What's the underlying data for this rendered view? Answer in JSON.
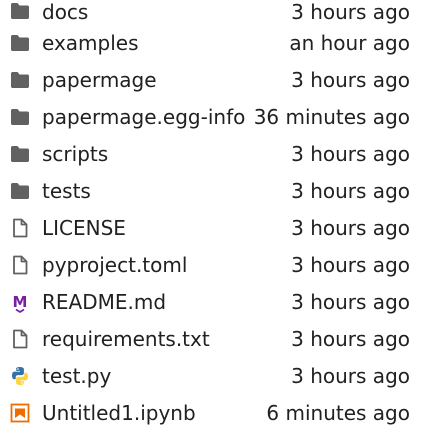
{
  "files": [
    {
      "name": "docs",
      "modified": "3 hours ago",
      "icon": "folder-icon"
    },
    {
      "name": "examples",
      "modified": "an hour ago",
      "icon": "folder-icon"
    },
    {
      "name": "papermage",
      "modified": "3 hours ago",
      "icon": "folder-icon"
    },
    {
      "name": "papermage.egg-info",
      "modified": "36 minutes ago",
      "icon": "folder-icon"
    },
    {
      "name": "scripts",
      "modified": "3 hours ago",
      "icon": "folder-icon"
    },
    {
      "name": "tests",
      "modified": "3 hours ago",
      "icon": "folder-icon"
    },
    {
      "name": "LICENSE",
      "modified": "3 hours ago",
      "icon": "file-icon"
    },
    {
      "name": "pyproject.toml",
      "modified": "3 hours ago",
      "icon": "file-icon"
    },
    {
      "name": "README.md",
      "modified": "3 hours ago",
      "icon": "markdown-icon"
    },
    {
      "name": "requirements.txt",
      "modified": "3 hours ago",
      "icon": "file-icon"
    },
    {
      "name": "test.py",
      "modified": "3 hours ago",
      "icon": "python-icon"
    },
    {
      "name": "Untitled1.ipynb",
      "modified": "6 minutes ago",
      "icon": "notebook-icon"
    }
  ],
  "colors": {
    "folder": "#616161",
    "markdown": "#7b1fa2",
    "python_blue": "#3572a5",
    "python_yellow": "#ffd43b",
    "notebook": "#ef6c00",
    "text": "#212121"
  }
}
